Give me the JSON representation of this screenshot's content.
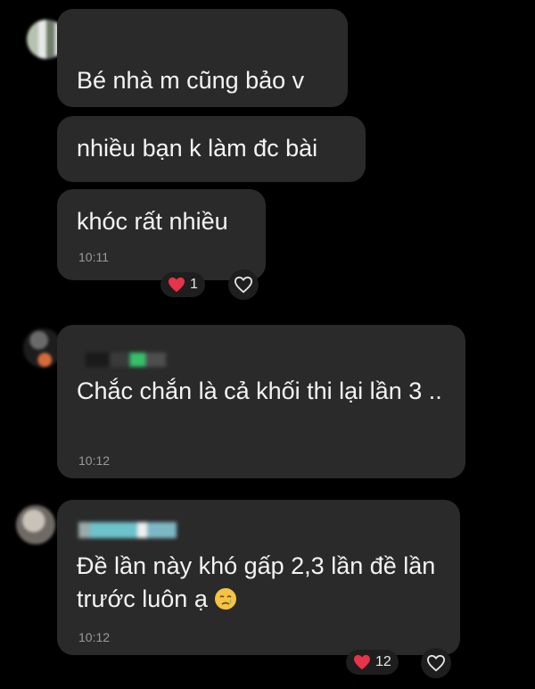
{
  "messages": [
    {
      "text": "Bé nhà m cũng bảo v"
    },
    {
      "text": "nhiều bạn k làm đc bài"
    },
    {
      "text": "khóc rất nhiều",
      "time": "10:11",
      "reaction_count": "1"
    },
    {
      "text": "Chắc chắn là cả khối thi lại lần 3 ..",
      "time": "10:12"
    },
    {
      "text": "Đề lần này khó gấp 2,3 lần đề lần trước luôn ạ",
      "time": "10:12",
      "reaction_count": "12"
    }
  ],
  "icons": {
    "reaction": "heart-icon",
    "like": "heart-outline-icon",
    "emoji": "crying-face-emoji"
  },
  "colors": {
    "background": "#000000",
    "bubble": "#2a2a2a",
    "heart": "#e8334a"
  }
}
